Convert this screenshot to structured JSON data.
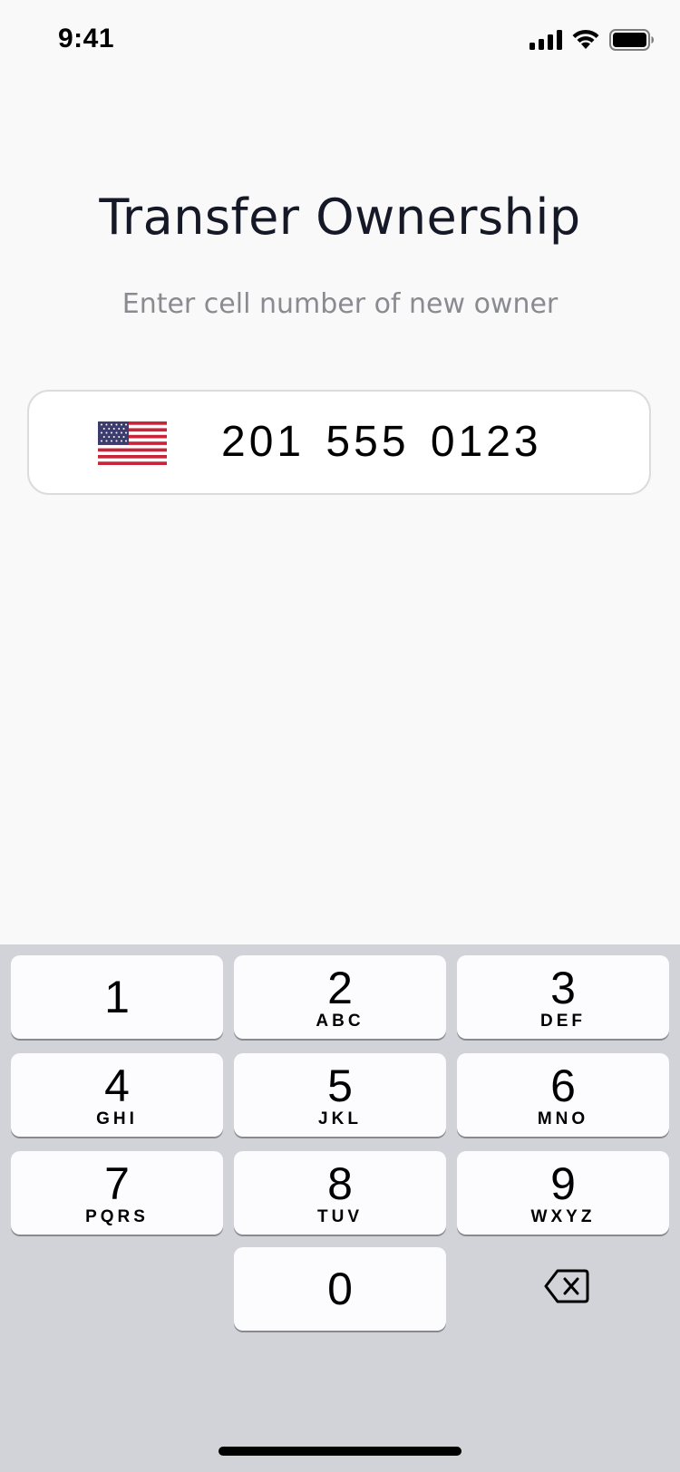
{
  "status_bar": {
    "time": "9:41",
    "icons": [
      "cellular-signal-icon",
      "wifi-icon",
      "battery-icon"
    ]
  },
  "header": {
    "title": "Transfer Ownership",
    "subtitle": "Enter cell number of new owner"
  },
  "phone_input": {
    "country_flag_icon": "us-flag-icon",
    "value": "201 555 0123"
  },
  "keypad": {
    "keys": [
      {
        "digit": "1",
        "letters": ""
      },
      {
        "digit": "2",
        "letters": "ABC"
      },
      {
        "digit": "3",
        "letters": "DEF"
      },
      {
        "digit": "4",
        "letters": "GHI"
      },
      {
        "digit": "5",
        "letters": "JKL"
      },
      {
        "digit": "6",
        "letters": "MNO"
      },
      {
        "digit": "7",
        "letters": "PQRS"
      },
      {
        "digit": "8",
        "letters": "TUV"
      },
      {
        "digit": "9",
        "letters": "WXYZ"
      },
      {
        "digit": "0",
        "letters": ""
      }
    ],
    "delete_icon": "backspace-icon",
    "colors": {
      "background": "#d1d3d9",
      "key": "#fcfcfe"
    }
  }
}
